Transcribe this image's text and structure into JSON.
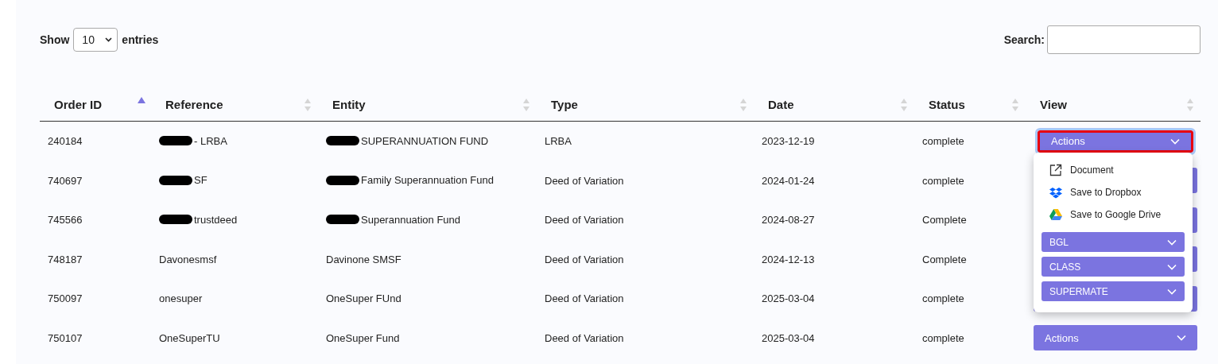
{
  "length_control": {
    "before": "Show",
    "value": "10",
    "after": "entries"
  },
  "search": {
    "label": "Search:"
  },
  "table": {
    "columns": [
      {
        "label": "Order ID",
        "sorted": true
      },
      {
        "label": "Reference",
        "sorted": false
      },
      {
        "label": "Entity",
        "sorted": false
      },
      {
        "label": "Type",
        "sorted": false
      },
      {
        "label": "Date",
        "sorted": false
      },
      {
        "label": "Status",
        "sorted": false
      },
      {
        "label": "View",
        "sorted": false
      }
    ],
    "rows": [
      {
        "order_id": "240184",
        "reference": {
          "redacted": true,
          "text": "- LRBA"
        },
        "entity": {
          "redacted": true,
          "text": "SUPERANNUATION FUND"
        },
        "type": "LRBA",
        "date": "2023-12-19",
        "status": "complete",
        "view": {
          "focused": true,
          "label": "Actions"
        }
      },
      {
        "order_id": "740697",
        "reference": {
          "redacted": true,
          "text": "SF"
        },
        "entity": {
          "redacted": true,
          "text": "Family Superannuation Fund"
        },
        "type": "Deed of Variation",
        "date": "2024-01-24",
        "status": "complete",
        "view": {
          "focused": false
        }
      },
      {
        "order_id": "745566",
        "reference": {
          "redacted": true,
          "text": "trustdeed"
        },
        "entity": {
          "redacted": true,
          "text": "Superannuation Fund"
        },
        "type": "Deed of Variation",
        "date": "2024-08-27",
        "status": "Complete",
        "view": {
          "focused": false
        }
      },
      {
        "order_id": "748187",
        "reference": {
          "redacted": false,
          "text": "Davonesmsf"
        },
        "entity": {
          "redacted": false,
          "text": "Davinone SMSF"
        },
        "type": "Deed of Variation",
        "date": "2024-12-13",
        "status": "Complete",
        "view": {
          "focused": false
        }
      },
      {
        "order_id": "750097",
        "reference": {
          "redacted": false,
          "text": "onesuper"
        },
        "entity": {
          "redacted": false,
          "text": "OneSuper FUnd"
        },
        "type": "Deed of Variation",
        "date": "2025-03-04",
        "status": "complete",
        "view": {
          "focused": false
        }
      },
      {
        "order_id": "750107",
        "reference": {
          "redacted": false,
          "text": "OneSuperTU"
        },
        "entity": {
          "redacted": false,
          "text": "OneSuper Fund"
        },
        "type": "Deed of Variation",
        "date": "2025-03-04",
        "status": "complete",
        "view": {
          "focused": false,
          "label": "Actions"
        }
      }
    ]
  },
  "actions_menu": {
    "items": [
      {
        "kind": "link",
        "label": "Document"
      },
      {
        "kind": "link",
        "label": "Save to Dropbox"
      },
      {
        "kind": "link",
        "label": "Save to Google Drive"
      },
      {
        "kind": "submenu",
        "label": "BGL"
      },
      {
        "kind": "submenu",
        "label": "CLASS"
      },
      {
        "kind": "submenu",
        "label": "SUPERMATE"
      }
    ]
  }
}
